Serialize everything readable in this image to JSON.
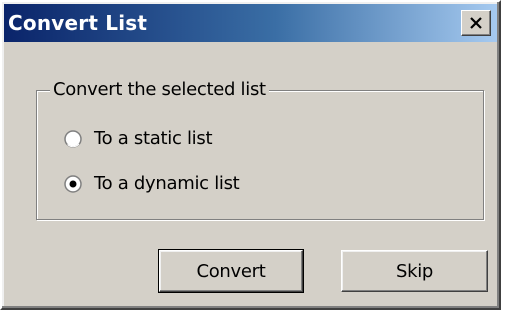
{
  "window": {
    "title": "Convert List",
    "titlebar_gradient": [
      "#0a246a",
      "#a6caf0"
    ],
    "close_icon": "close-x-icon"
  },
  "group": {
    "legend": "Convert the selected list",
    "options": [
      {
        "label": "To a static list",
        "selected": false
      },
      {
        "label": "To a dynamic list",
        "selected": true
      }
    ]
  },
  "buttons": {
    "convert_label": "Convert",
    "skip_label": "Skip"
  }
}
